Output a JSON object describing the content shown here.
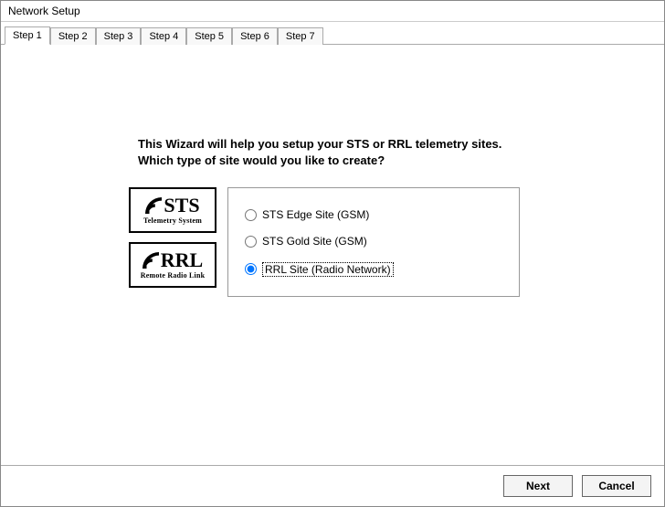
{
  "window": {
    "title": "Network Setup"
  },
  "tabs": [
    {
      "label": "Step 1"
    },
    {
      "label": "Step 2"
    },
    {
      "label": "Step 3"
    },
    {
      "label": "Step 4"
    },
    {
      "label": "Step 5"
    },
    {
      "label": "Step 6"
    },
    {
      "label": "Step 7"
    }
  ],
  "heading": {
    "line1": "This Wizard will help you setup your STS or RRL telemetry sites.",
    "line2": "Which type of site would you like to create?"
  },
  "logos": {
    "sts": {
      "main": "STS",
      "sub": "Telemetry System"
    },
    "rrl": {
      "main": "RRL",
      "sub": "Remote Radio Link"
    }
  },
  "options": [
    {
      "key": "sts_edge",
      "label": "STS Edge Site (GSM)",
      "selected": false
    },
    {
      "key": "sts_gold",
      "label": "STS Gold Site (GSM)",
      "selected": false
    },
    {
      "key": "rrl",
      "label": "RRL Site (Radio Network)",
      "selected": true
    }
  ],
  "buttons": {
    "next": "Next",
    "cancel": "Cancel"
  }
}
